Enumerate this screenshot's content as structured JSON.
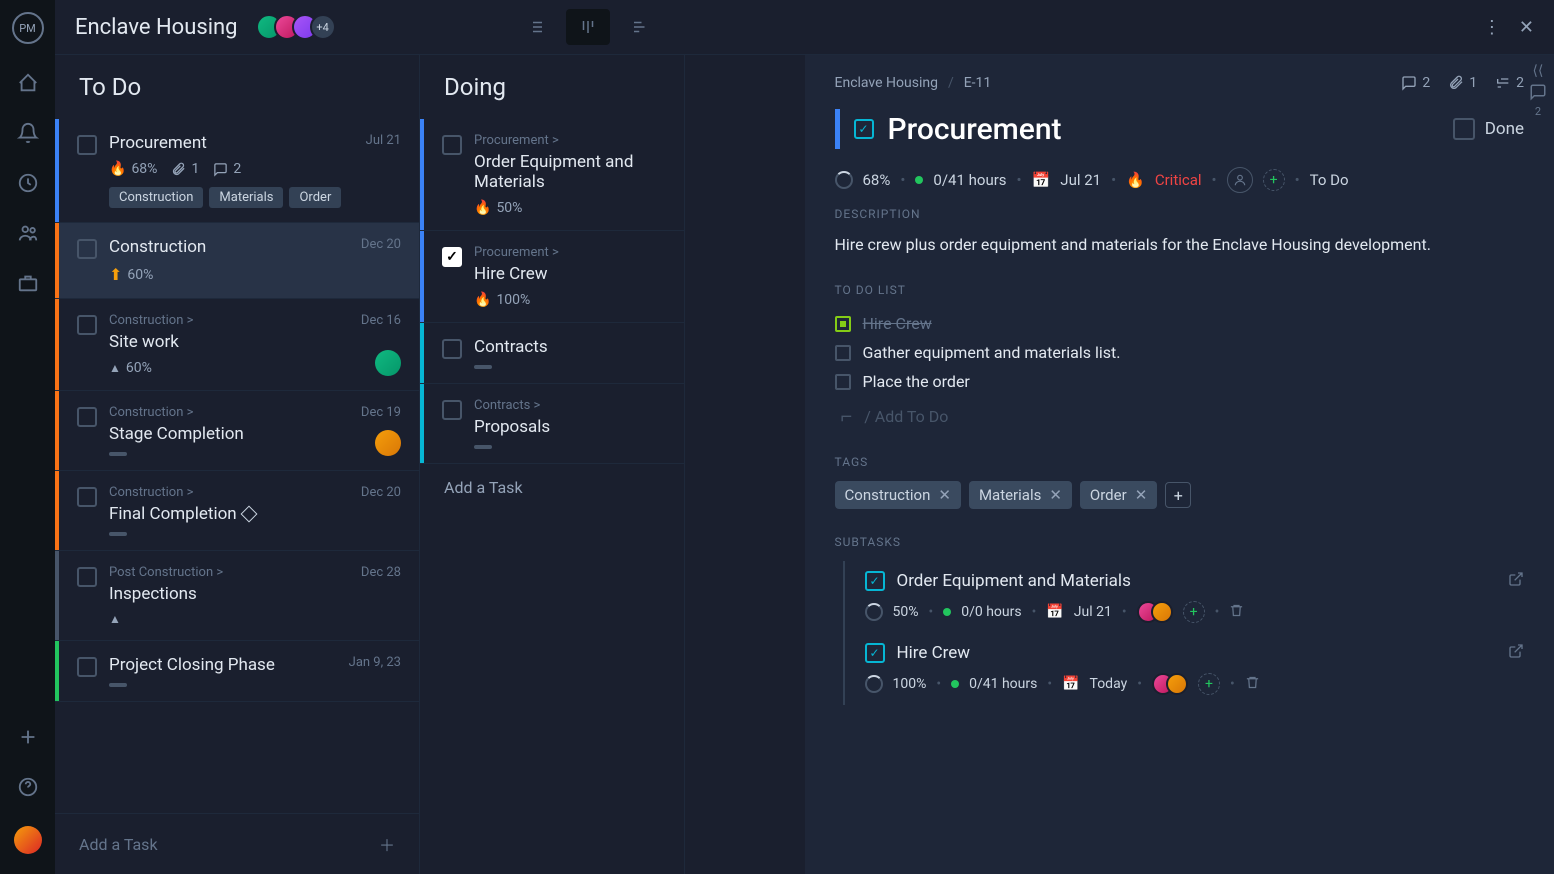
{
  "project": {
    "title": "Enclave Housing",
    "avatar_more": "+4"
  },
  "columns": {
    "todo": {
      "title": "To Do",
      "add": "Add a Task",
      "cards": [
        {
          "title": "Procurement",
          "date": "Jul 21",
          "percent": "68%",
          "attach": "1",
          "comments": "2",
          "tags": [
            "Construction",
            "Materials",
            "Order"
          ],
          "bar": "bar-blue",
          "priority": "fire"
        },
        {
          "title": "Construction",
          "date": "Dec 20",
          "percent": "60%",
          "bar": "bar-orange",
          "priority": "arrow-up",
          "selected": true
        },
        {
          "parent": "Construction >",
          "title": "Site work",
          "date": "Dec 16",
          "percent": "60%",
          "bar": "bar-orange",
          "priority": "arrow-tri",
          "avatar": "av1"
        },
        {
          "parent": "Construction >",
          "title": "Stage Completion",
          "date": "Dec 19",
          "bar": "bar-orange",
          "progress_bar": true,
          "avatar": "av4"
        },
        {
          "parent": "Construction >",
          "title": "Final Completion",
          "date": "Dec 20",
          "bar": "bar-orange",
          "progress_bar": true,
          "diamond": true
        },
        {
          "parent": "Post Construction >",
          "title": "Inspections",
          "date": "Dec 28",
          "bar": "bar-gray",
          "priority": "arrow-tri"
        },
        {
          "title": "Project Closing Phase",
          "date": "Jan 9, 23",
          "bar": "bar-green",
          "progress_bar": true
        }
      ]
    },
    "doing": {
      "title": "Doing",
      "add": "Add a Task",
      "cards": [
        {
          "parent": "Procurement >",
          "title": "Order Equipment and Materials",
          "percent": "50%",
          "bar": "bar-blue",
          "priority": "fire"
        },
        {
          "parent": "Procurement >",
          "title": "Hire Crew",
          "percent": "100%",
          "bar": "bar-blue",
          "priority": "fire",
          "checked": true
        },
        {
          "title": "Contracts",
          "bar": "bar-cyan",
          "progress_bar": true
        },
        {
          "parent": "Contracts >",
          "title": "Proposals",
          "bar": "bar-cyan",
          "progress_bar": true
        }
      ]
    }
  },
  "detail": {
    "breadcrumb": {
      "project": "Enclave Housing",
      "id": "E-11"
    },
    "stats": {
      "comments": "2",
      "attach": "1",
      "subtasks": "2"
    },
    "title": "Procurement",
    "done_label": "Done",
    "meta": {
      "percent": "68%",
      "hours": "0/41 hours",
      "date": "Jul 21",
      "priority": "Critical",
      "status": "To Do"
    },
    "description": {
      "label": "Description",
      "text": "Hire crew plus order equipment and materials for the Enclave Housing development."
    },
    "todolist": {
      "label": "To Do List",
      "items": [
        {
          "text": "Hire Crew",
          "done": true
        },
        {
          "text": "Gather equipment and materials list.",
          "done": false
        },
        {
          "text": "Place the order",
          "done": false
        }
      ],
      "add": "/ Add To Do"
    },
    "tags": {
      "label": "Tags",
      "items": [
        "Construction",
        "Materials",
        "Order"
      ]
    },
    "subtasks": {
      "label": "Subtasks",
      "items": [
        {
          "title": "Order Equipment and Materials",
          "percent": "50%",
          "hours": "0/0 hours",
          "date": "Jul 21"
        },
        {
          "title": "Hire Crew",
          "percent": "100%",
          "hours": "0/41 hours",
          "date": "Today"
        }
      ]
    },
    "collapse_badge": "2"
  }
}
